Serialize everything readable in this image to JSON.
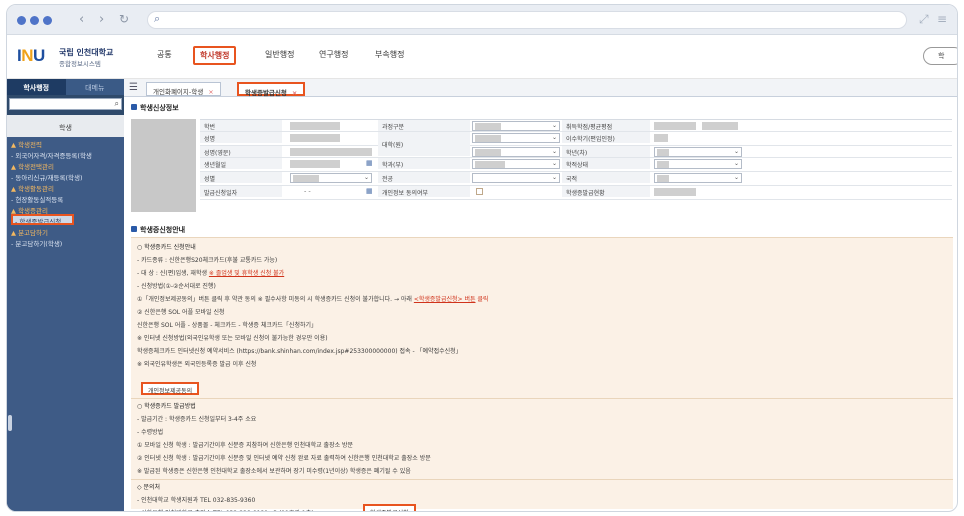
{
  "browser": {
    "address": ""
  },
  "header": {
    "logo_mark": "INU",
    "logo_title": "국립 인천대학교",
    "logo_subtitle": "종합정보시스템",
    "menu": [
      "공통",
      "학사행정",
      "일반행정",
      "연구행정",
      "부속행정"
    ],
    "active_menu": "학사행정",
    "right_pill": "학"
  },
  "sidebar": {
    "tabs": [
      "학사행정",
      "대메뉴"
    ],
    "category": "학생",
    "items": [
      {
        "label": "▲ 학생전력",
        "type": "grp"
      },
      {
        "label": "- 외국어자격/자격증등록(학생",
        "type": "item"
      },
      {
        "label": "▲ 학생전택관리",
        "type": "grp"
      },
      {
        "label": "- 동아리신규/재등록(학생)",
        "type": "item"
      },
      {
        "label": "▲ 학생활동관리",
        "type": "grp"
      },
      {
        "label": "- 현장활동실적등록",
        "type": "item"
      },
      {
        "label": "▲ 학생증관리",
        "type": "grp"
      },
      {
        "label": "- 학생증발급신청",
        "type": "sel"
      },
      {
        "label": "▲ 분고담하기",
        "type": "grp"
      },
      {
        "label": "- 분고담하기(학생)",
        "type": "item"
      }
    ]
  },
  "tabs": [
    {
      "label": "개인화폐이지-학생",
      "active": false
    },
    {
      "label": "학생증발급신청",
      "active": true
    }
  ],
  "student_info": {
    "title": "학생신상정보",
    "labels": {
      "student_no": "학번",
      "name": "성명",
      "name_en": "성명(영문)",
      "birth": "생년월일",
      "gender": "성별",
      "issue_date": "발급신청일자",
      "course": "과정구분",
      "dept": "대학(원)",
      "major_dept": "학과(부)",
      "major": "전공",
      "privacy": "개인정보 동의여부",
      "admission": "취득학점/평균평점",
      "transfer": "이수학기(편입인정)",
      "grade": "학년(차)",
      "status": "학적상태",
      "nationality": "국적",
      "card_status": "학생증발급현황"
    },
    "issue_date_value": "- -"
  },
  "guide": {
    "title": "학생증신청안내",
    "lines": [
      {
        "text": "○ 학생증카드 신청안내",
        "h": true
      },
      {
        "text": "- 카드종류 : 신한은행S20체크카드(후불 교통카드 가능)"
      },
      {
        "text": "- 대   상 : 신(편)입생, 재학생 ",
        "red": "※ 졸업생 및 휴학생 신청 불가"
      },
      {
        "text": "- 신청방법(①-②순서대로 진행)"
      },
      {
        "text": "①「개인정보제공동의」버튼 클릭 후 약관 동의  ※ 필수사항 미동의 시 학생증카드 신청이 불가합니다. → 아래 ",
        "red": "<학생증발급신청> 버튼",
        "tail": " 클릭"
      },
      {
        "text": "② 신한은행 SOL 어플 모바일 신청"
      },
      {
        "text": "   신한은행 SOL 어플 - 상품몰 - 체크카드 - 학생증 체크카드「신청하기」"
      },
      {
        "text": "   ※ 인터넷 신청방법(외국인유학생 또는 모바일 신청이 불가능한 경우만 이용)"
      },
      {
        "text": "   학생증체크카드 인터넷신청 예약서비스 (https://bank.shinhan.com/index.jsp#253300000000) 접속 - 「예약접수신청」"
      },
      {
        "text": "   ※ 외국인유학생은 외국인등록증 발급 이후 신청"
      }
    ],
    "privacy_button": "개인정보제공동의",
    "lines2": [
      {
        "text": "○ 학생증카드 발급방법",
        "h": true
      },
      {
        "text": "- 발급기간 : 학생증카드 신청일부터 3-4주 소요"
      },
      {
        "text": "- 수령방법"
      },
      {
        "text": "① 모바일 신청 학생 : 발급기간이후 신분증 지참하여 신한은행 인천대학교 출장소 방문"
      },
      {
        "text": "② 인터넷 신청 학생 : 발급기간이후 신분증 및 인터넷 예약 신청 완료 자료 출력하여 신한은행 인천대학교 출장소 방문"
      },
      {
        "text": "※ 발급된 학생증은 신한은행 인천대학교 출장소에서 보관하며 장기 미수령(1년이상) 학생증은 폐기될 수 있음"
      }
    ],
    "lines3": [
      {
        "text": "◇ 문의처",
        "h": true
      },
      {
        "text": "- 인천대학교 학생지원과 TEL 032-835-9360"
      },
      {
        "text": "- 신한은행 인천대학교 출장소 TEL 032-228-9121~3 (11호관 1층)"
      }
    ],
    "apply_button": "학생증발급신청"
  },
  "colors": {
    "accent": "#e8541f",
    "sidebar": "#2f4a6b",
    "brand": "#1f4f9f"
  }
}
